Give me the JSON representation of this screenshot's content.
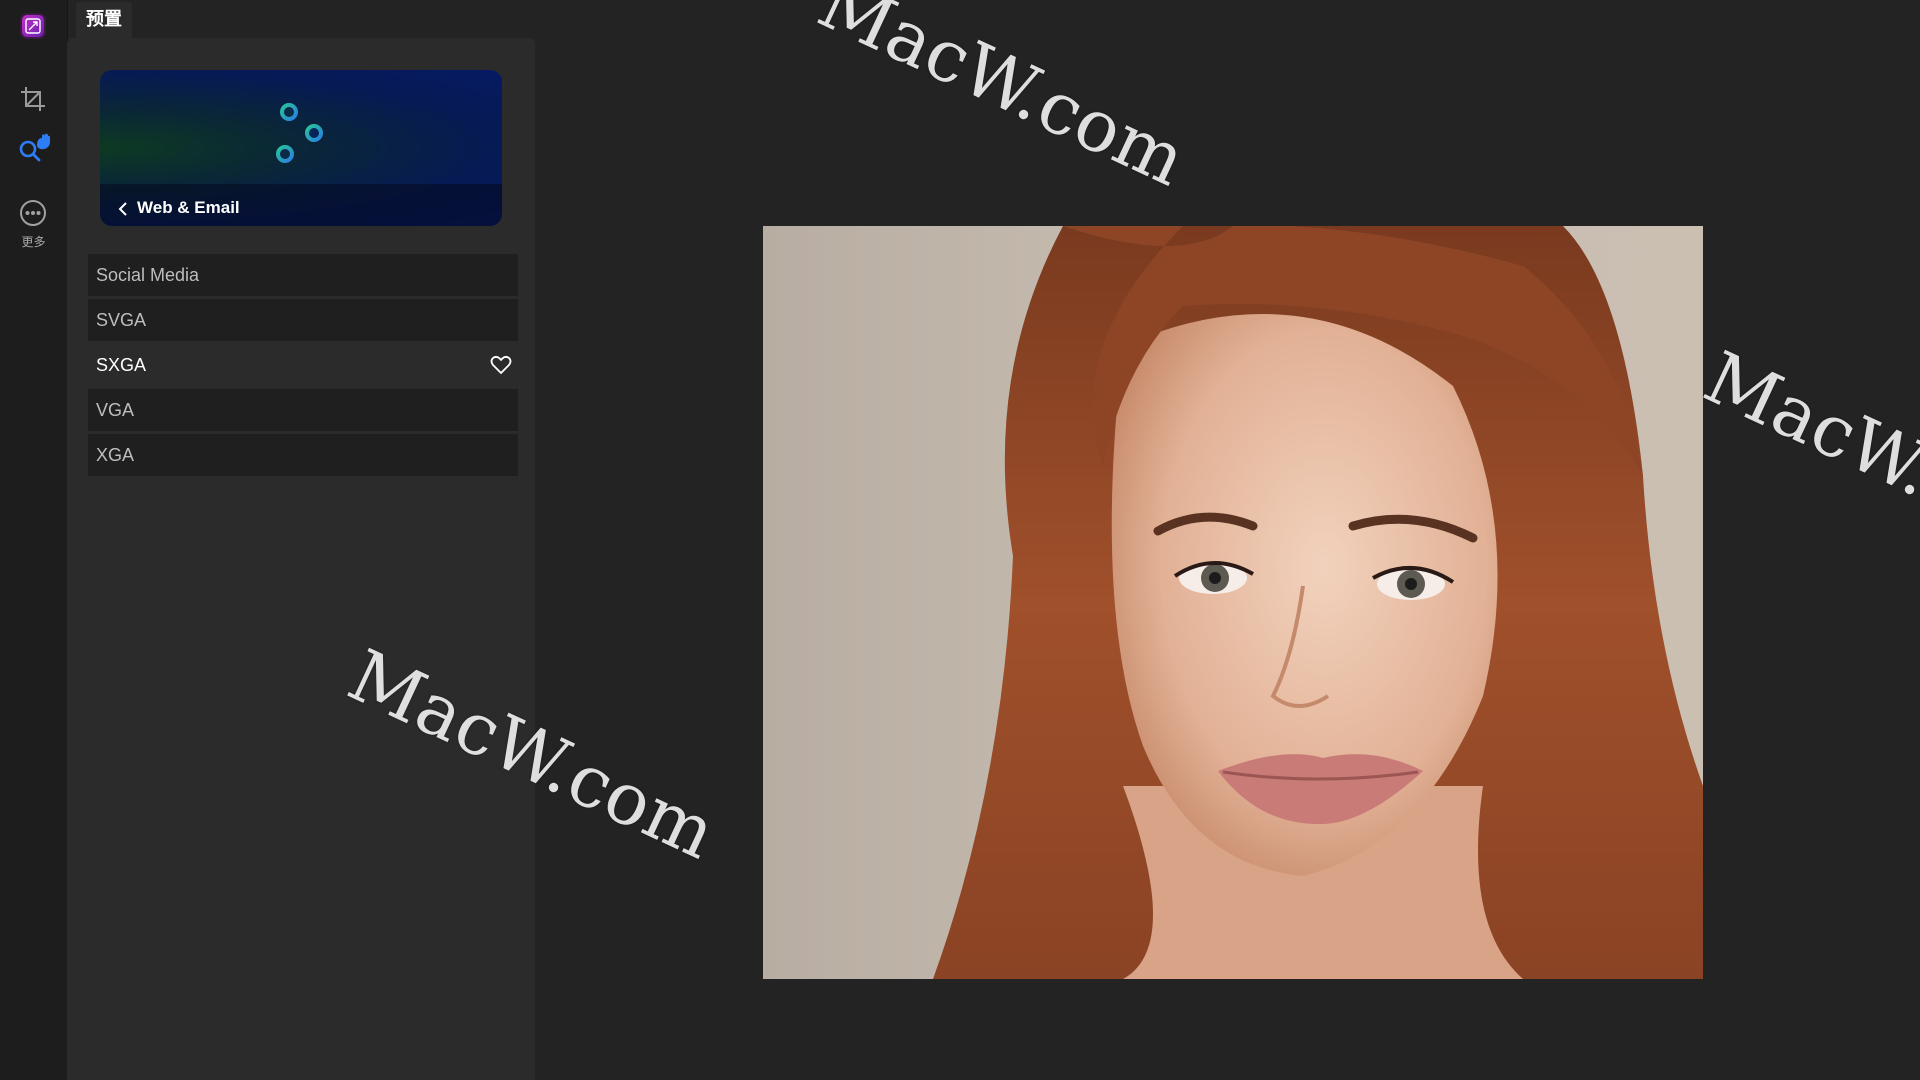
{
  "panel": {
    "tab_label": "预置",
    "banner_title": "Web & Email",
    "presets": [
      {
        "label": "Social Media",
        "active": false
      },
      {
        "label": "SVGA",
        "active": false
      },
      {
        "label": "SXGA",
        "active": true
      },
      {
        "label": "VGA",
        "active": false
      },
      {
        "label": "XGA",
        "active": false
      }
    ]
  },
  "toolbar": {
    "more_label": "更多",
    "tools": [
      "crop-icon",
      "search-hand-icon",
      "more-icon"
    ]
  },
  "watermarks": [
    "MacW.com",
    "MacW.com",
    "MacW.c"
  ],
  "colors": {
    "accent": "#2f7df6",
    "banner_start": "#0d3a22",
    "banner_end": "#051a63"
  }
}
